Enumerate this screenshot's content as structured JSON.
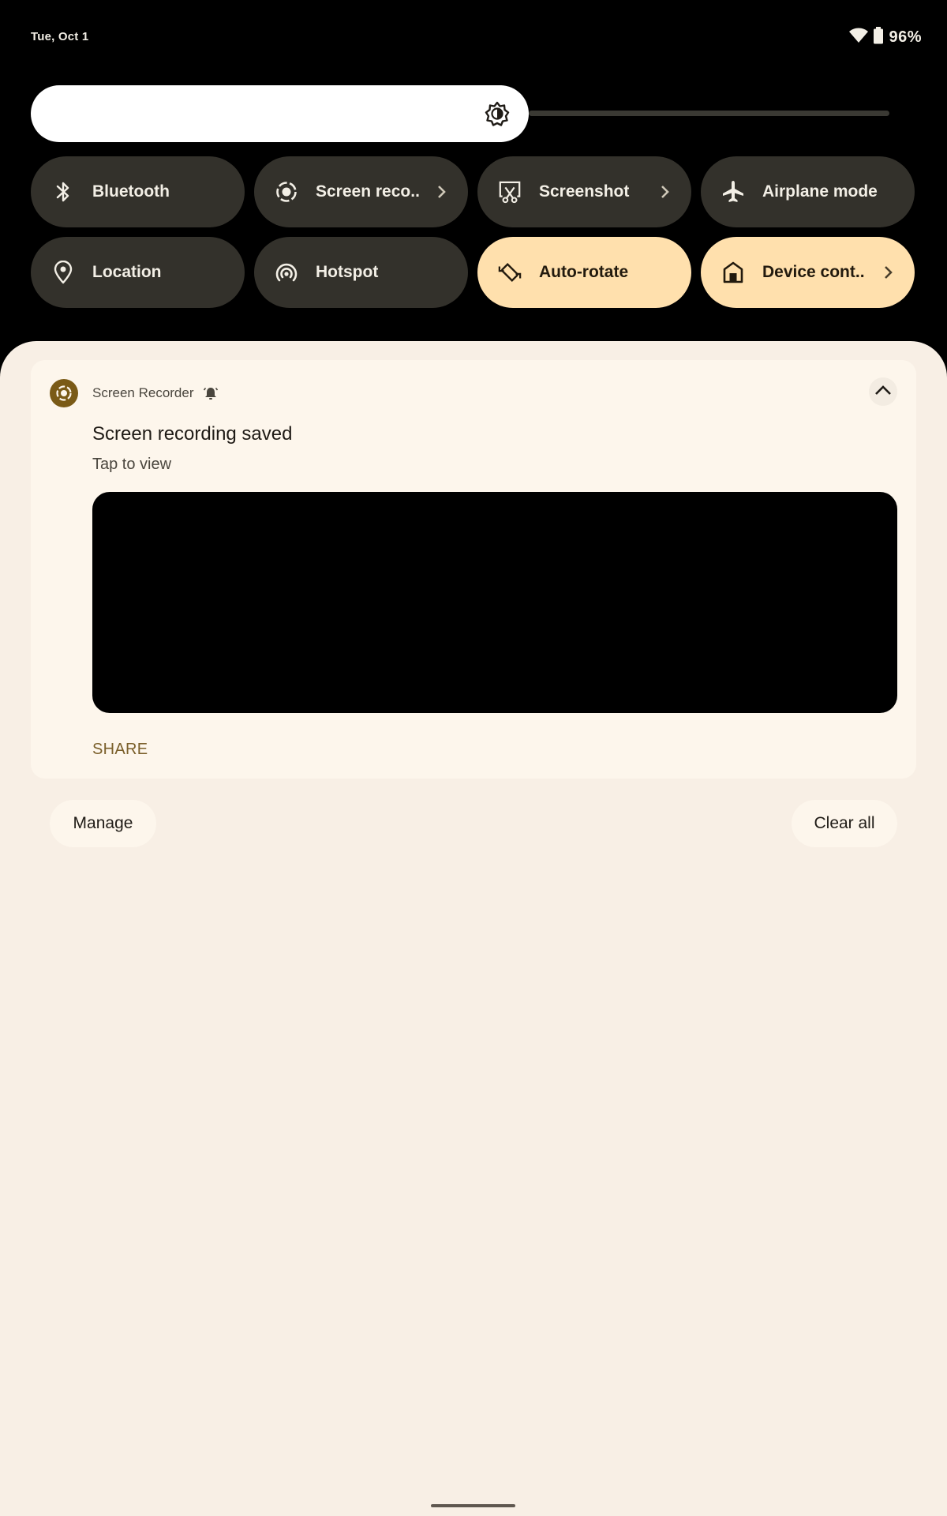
{
  "status_bar": {
    "date": "Tue, Oct 1",
    "wifi_icon": "wifi-icon",
    "battery_icon": "battery-icon",
    "battery_percent": "96%"
  },
  "brightness": {
    "icon": "brightness-auto-icon",
    "level_fraction": 0.58
  },
  "quick_settings": {
    "tiles": [
      {
        "label": "Bluetooth",
        "icon": "bluetooth-icon",
        "active": false,
        "has_chevron": false
      },
      {
        "label": "Screen reco..",
        "icon": "screen-record-icon",
        "active": false,
        "has_chevron": true
      },
      {
        "label": "Screenshot",
        "icon": "screenshot-icon",
        "active": false,
        "has_chevron": true
      },
      {
        "label": "Airplane mode",
        "icon": "airplane-icon",
        "active": false,
        "has_chevron": false
      },
      {
        "label": "Location",
        "icon": "location-icon",
        "active": false,
        "has_chevron": false
      },
      {
        "label": "Hotspot",
        "icon": "hotspot-icon",
        "active": false,
        "has_chevron": false
      },
      {
        "label": "Auto-rotate",
        "icon": "auto-rotate-icon",
        "active": true,
        "has_chevron": false
      },
      {
        "label": "Device cont..",
        "icon": "home-icon",
        "active": true,
        "has_chevron": true
      }
    ]
  },
  "notification": {
    "app_name": "Screen Recorder",
    "app_icon": "screen-record-icon",
    "alert_icon": "bell-icon",
    "title": "Screen recording saved",
    "text": "Tap to view",
    "action": "SHARE",
    "expand_icon": "chevron-up-icon"
  },
  "footer": {
    "manage_label": "Manage",
    "clear_all_label": "Clear all"
  },
  "colors": {
    "tile_off": "#33312b",
    "tile_on": "#ffe0ad",
    "shade_bg": "#f8efe5",
    "card_bg": "#fdf6ec",
    "accent": "#7a5a16",
    "action_text": "#7a5f2a"
  }
}
